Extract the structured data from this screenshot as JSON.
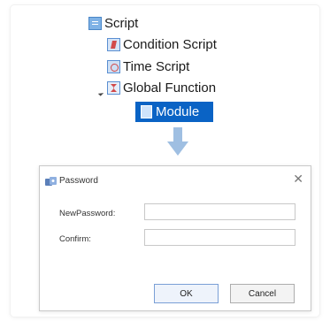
{
  "tree": {
    "items": [
      {
        "label": "Script",
        "icon": "script-icon"
      },
      {
        "label": "Condition Script",
        "icon": "condition-script-icon"
      },
      {
        "label": "Time Script",
        "icon": "time-script-icon"
      },
      {
        "label": "Global Function",
        "icon": "global-function-icon",
        "expanded": true
      },
      {
        "label": "Module",
        "icon": "module-icon",
        "selected": true
      }
    ]
  },
  "arrow": {
    "icon": "down-arrow-icon",
    "color": "#9fbfe2"
  },
  "dialog": {
    "title": "Password",
    "icon": "key-icon",
    "close_glyph": "✕",
    "fields": [
      {
        "label": "NewPassword:",
        "value": ""
      },
      {
        "label": "Confirm:",
        "value": ""
      }
    ],
    "buttons": {
      "ok": "OK",
      "cancel": "Cancel"
    }
  },
  "colors": {
    "selection": "#0a63c5",
    "selection_text": "#ffffff",
    "arrow": "#9fbfe2"
  }
}
